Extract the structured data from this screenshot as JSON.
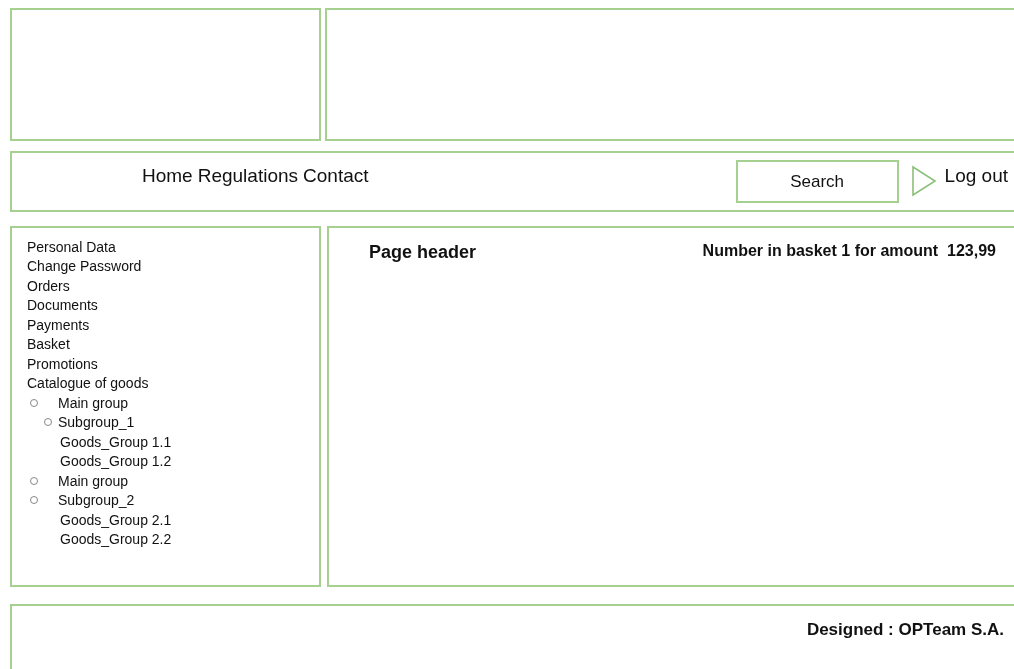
{
  "nav": {
    "links": [
      "Home",
      "Regulations",
      "Contact"
    ],
    "search_button": "Search",
    "logout": "Log out"
  },
  "sidebar": {
    "items": [
      {
        "label": "Personal Data"
      },
      {
        "label": "Change Password"
      },
      {
        "label": "Orders"
      },
      {
        "label": "Documents"
      },
      {
        "label": "Payments"
      },
      {
        "label": "Basket"
      },
      {
        "label": "Promotions"
      },
      {
        "label": "Catalogue of goods",
        "children": [
          {
            "label": "Main group",
            "bullet": true,
            "children": [
              {
                "label": "Subgroup_1",
                "bullet": true,
                "children": [
                  {
                    "label": "Goods_Group 1.1"
                  },
                  {
                    "label": "Goods_Group 1.2"
                  }
                ]
              }
            ]
          },
          {
            "label": "Main group",
            "bullet": true
          },
          {
            "label": "Subgroup_2",
            "bullet": true,
            "children": [
              {
                "label": "Goods_Group 2.1"
              },
              {
                "label": "Goods_Group 2.2"
              }
            ]
          }
        ]
      }
    ]
  },
  "main": {
    "header": "Page header",
    "basket_info": "Number in basket 1 for amount  123,99"
  },
  "footer": {
    "text": "Designed : OPTeam S.A."
  }
}
